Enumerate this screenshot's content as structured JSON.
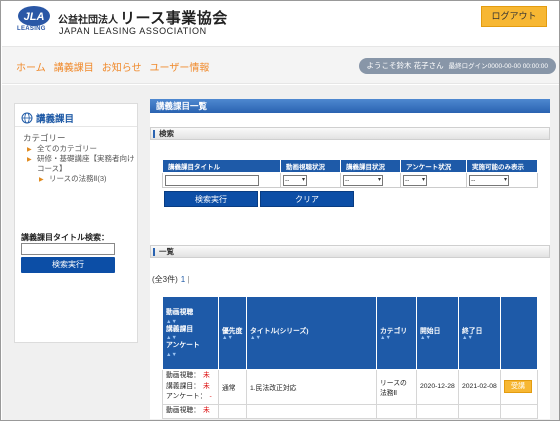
{
  "header": {
    "logo_mark": "JLA",
    "logo_leasing": "LEASING",
    "org_prefix": "公益社団法人",
    "org_name": "リース事業協会",
    "org_english": "JAPAN LEASING ASSOCIATION",
    "logout_label": "ログアウト"
  },
  "nav": {
    "items": [
      "ホーム",
      "講義課目",
      "お知らせ",
      "ユーザー情報"
    ],
    "welcome": "ようこそ鈴木 花子さん",
    "last_login": "最終ログイン0000-00-00 00:00:00"
  },
  "sidebar": {
    "title": "講義課目",
    "category_label": "カテゴリー",
    "categories": [
      {
        "label": "全てのカテゴリー",
        "level": 0
      },
      {
        "label": "研修・基礎講座【実務者向けコース】",
        "level": 0
      },
      {
        "label": "リースの法務Ⅱ(3)",
        "level": 1
      }
    ],
    "search_label": "講義課目タイトル検索：",
    "search_value": "",
    "search_button": "検索実行"
  },
  "main": {
    "page_title": "講義課目一覧",
    "search_section": "検索",
    "search_columns": [
      "講義課目タイトル",
      "動画視聴状況",
      "講義課目状況",
      "アンケート状況",
      "実施可能のみ表示"
    ],
    "select_value": "--",
    "search_button": "検索実行",
    "clear_button": "クリア",
    "list_section": "一覧",
    "count_text": "(全3件)",
    "page_number": "1",
    "page_sep": "|",
    "sort_glyphs": "▲▼",
    "list_columns": {
      "status_labels": [
        "動画視聴",
        "講義課目",
        "アンケート"
      ],
      "priority": "優先度",
      "title": "タイトル(シリーズ)",
      "category": "カテゴリ",
      "start_date": "開始日",
      "end_date": "終了日"
    },
    "rows": [
      {
        "status": [
          {
            "label": "動画視聴",
            "value": "未"
          },
          {
            "label": "講義課目",
            "value": "未"
          },
          {
            "label": "アンケート",
            "value": "-"
          }
        ],
        "priority": "通常",
        "title": "1.民法改正対応",
        "category": "リースの法務Ⅱ",
        "start_date": "2020-12-28",
        "end_date": "2021-02-08",
        "action": "受講"
      },
      {
        "status": [
          {
            "label": "動画視聴",
            "value": "未"
          }
        ]
      }
    ]
  },
  "colors": {
    "brand_blue": "#1e5aa8",
    "accent_orange": "#f7b733",
    "nav_link": "#f08a2c"
  }
}
